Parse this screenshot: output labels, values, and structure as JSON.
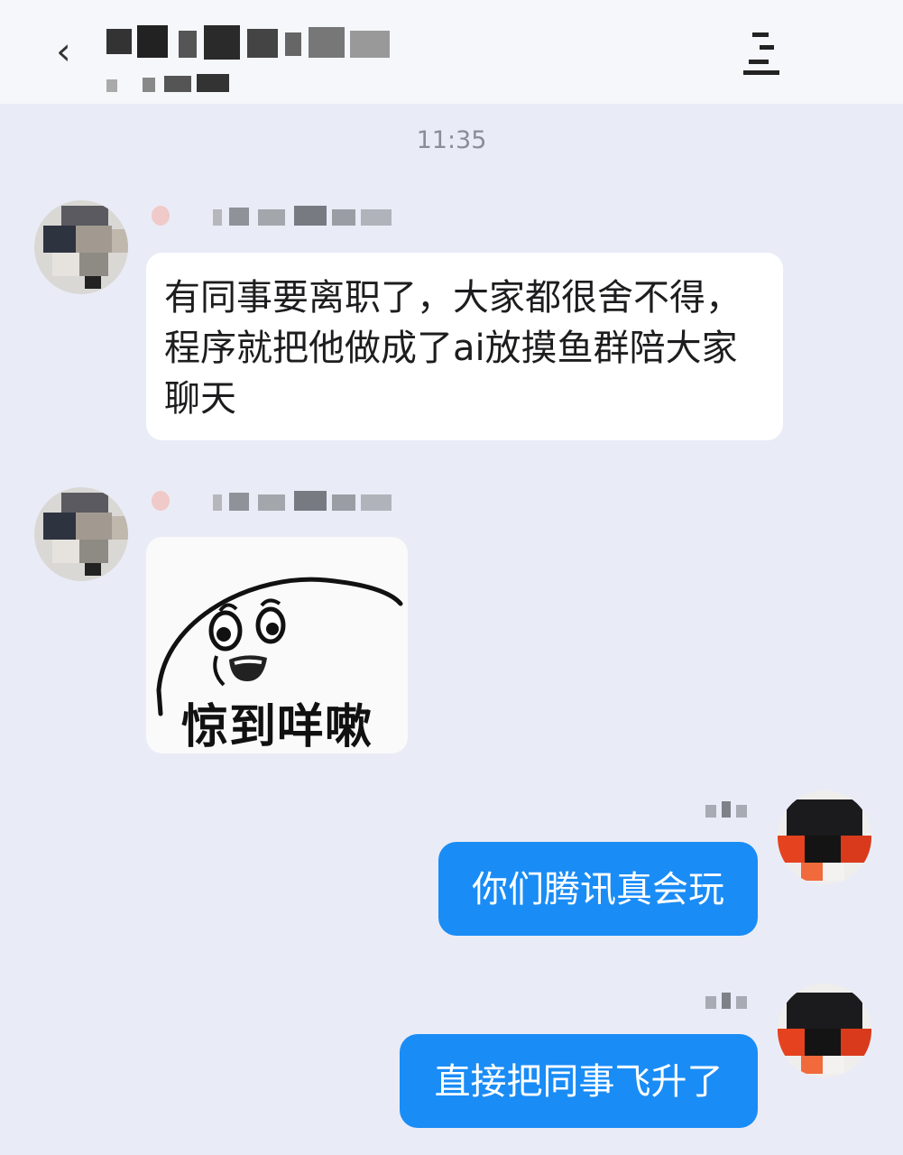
{
  "header": {
    "back_icon": "chevron-left-icon",
    "title_blurred": true,
    "subtitle_blurred": true,
    "menu_icon": "more-icon"
  },
  "time_stamp": "11:35",
  "messages": [
    {
      "side": "left",
      "sender_blurred": true,
      "text": "有同事要离职了，大家都很舍不得，程序就把他做成了ai放摸鱼群陪大家聊天"
    },
    {
      "side": "left",
      "sender_blurred": true,
      "type": "sticker",
      "sticker_caption": "惊到咩嗽"
    },
    {
      "side": "right",
      "sender_blurred": true,
      "text": "你们腾讯真会玩"
    },
    {
      "side": "right",
      "sender_blurred": true,
      "text": "直接把同事飞升了"
    }
  ],
  "colors": {
    "background": "#e9ecf6",
    "header": "#f6f7fa",
    "incoming_bubble": "#ffffff",
    "outgoing_bubble": "#1a8cf6"
  }
}
